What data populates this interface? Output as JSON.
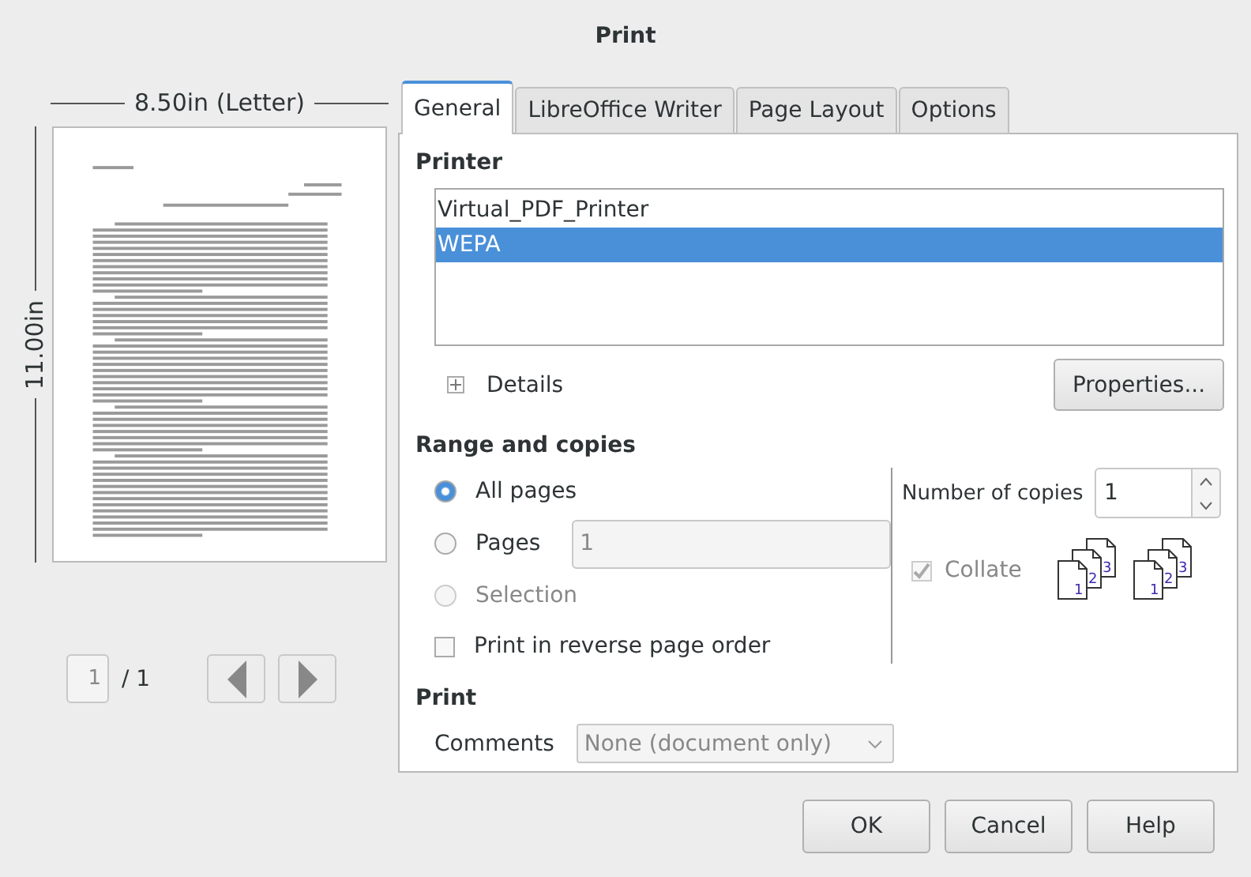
{
  "window": {
    "title": "Print"
  },
  "preview": {
    "width_label": "8.50in (Letter)",
    "height_label": "11.00in",
    "page": "1",
    "page_total": "/ 1"
  },
  "tabs": [
    {
      "label": "General",
      "selected": true
    },
    {
      "label": "LibreOffice Writer",
      "selected": false
    },
    {
      "label": "Page Layout",
      "selected": false
    },
    {
      "label": "Options",
      "selected": false
    }
  ],
  "printer": {
    "heading": "Printer",
    "printers": [
      {
        "name": "Virtual_PDF_Printer",
        "selected": false
      },
      {
        "name": "WEPA",
        "selected": true
      }
    ],
    "details": {
      "label": "Details",
      "expanded": false
    },
    "properties_button": "Properties..."
  },
  "range": {
    "heading": "Range and copies",
    "options": [
      {
        "label": "All pages",
        "selected": true,
        "disabled": false
      },
      {
        "label": "Pages",
        "selected": false,
        "disabled": false,
        "field": "1"
      },
      {
        "label": "Selection",
        "selected": false,
        "disabled": true
      }
    ],
    "reverse": {
      "label": "Print in reverse page order",
      "checked": false
    },
    "copies": {
      "label": "Number of copies",
      "value": "1"
    },
    "collate": {
      "label": "Collate",
      "checked": true,
      "disabled": true
    },
    "collate_icons": [
      {
        "pages": [
          "1",
          "2",
          "3"
        ]
      },
      {
        "pages": [
          "1",
          "2",
          "3"
        ]
      }
    ]
  },
  "print": {
    "heading": "Print",
    "comments_label": "Comments",
    "comments_value": "None (document only)"
  },
  "buttons": [
    "OK",
    "Cancel",
    "Help"
  ]
}
